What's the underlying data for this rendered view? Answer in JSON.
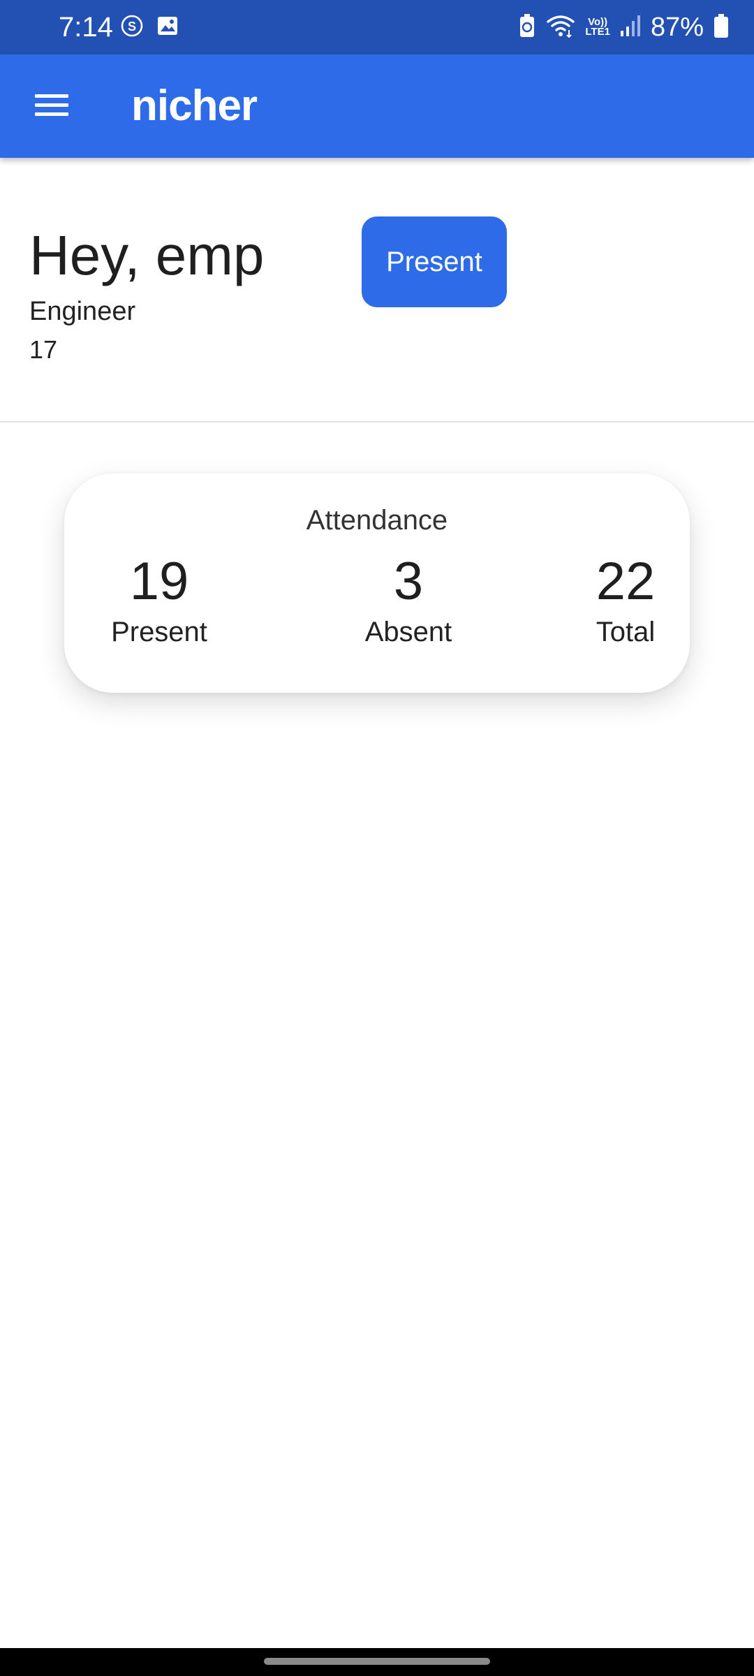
{
  "status_bar": {
    "time": "7:14",
    "battery": "87%",
    "network_label": "LTE1",
    "left_icons": [
      "sync-icon",
      "image-icon"
    ],
    "right_icons": [
      "battery-saver-icon",
      "wifi-icon",
      "volte-icon",
      "signal-icon",
      "battery-icon"
    ],
    "background": "#2351b3"
  },
  "app_bar": {
    "title": "nicher",
    "menu_icon": "hamburger-menu-icon",
    "background": "#2e6be8"
  },
  "profile": {
    "greeting": "Hey, emp",
    "role": "Engineer",
    "id": "17",
    "action_label": "Present",
    "accent": "#2e6be8"
  },
  "attendance": {
    "title": "Attendance",
    "stats": [
      {
        "value": "19",
        "label": "Present"
      },
      {
        "value": "3",
        "label": "Absent"
      },
      {
        "value": "22",
        "label": "Total"
      }
    ]
  }
}
